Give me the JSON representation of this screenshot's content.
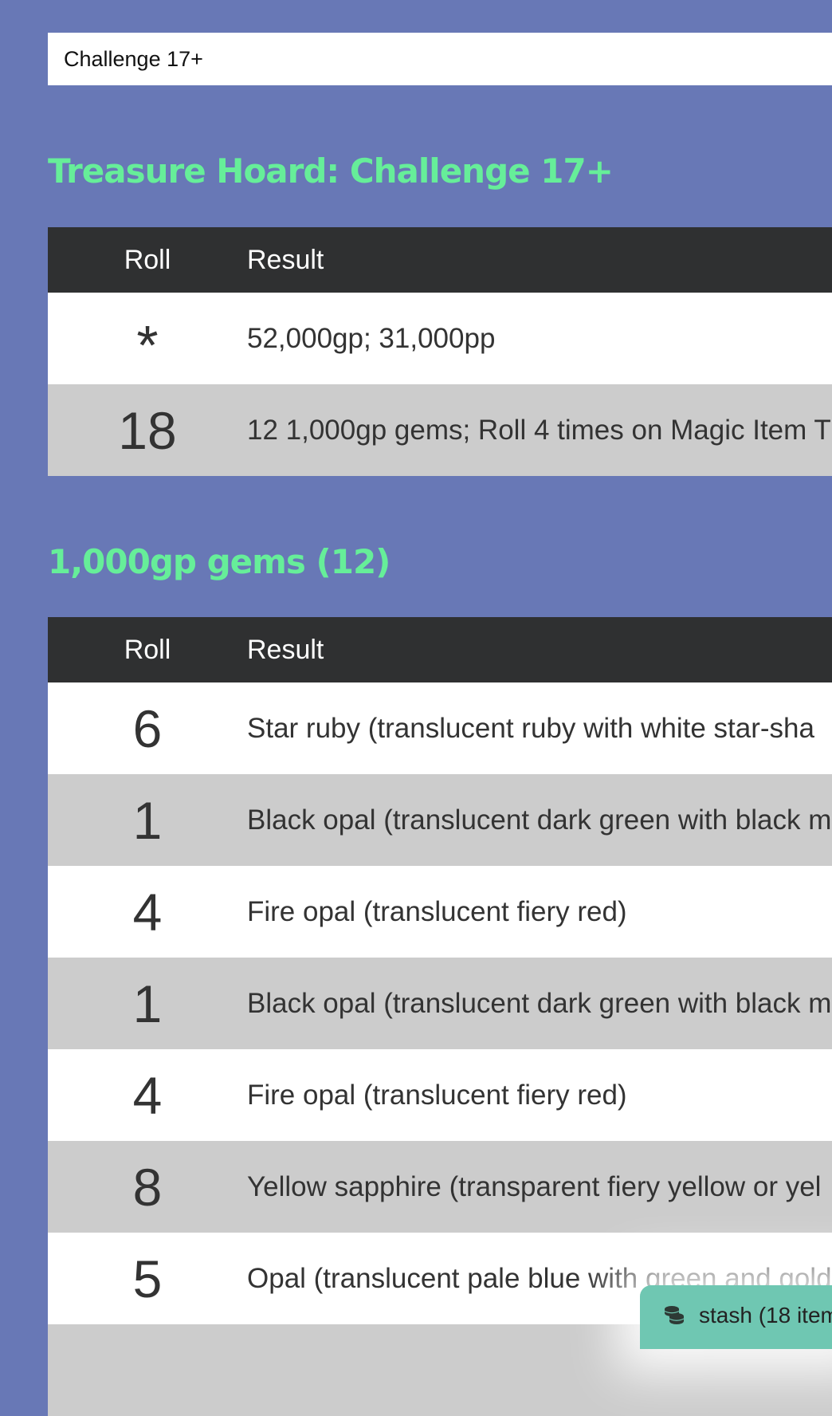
{
  "select": {
    "value": "Challenge 17+"
  },
  "hoard": {
    "title": "Treasure Hoard: Challenge 17+",
    "headers": {
      "roll": "Roll",
      "result": "Result"
    },
    "rows": [
      {
        "roll": "*",
        "result": "52,000gp; 31,000pp"
      },
      {
        "roll": "18",
        "result": "12 1,000gp gems; Roll 4 times on Magic Item T"
      }
    ]
  },
  "gems": {
    "title": "1,000gp gems (12)",
    "headers": {
      "roll": "Roll",
      "result": "Result"
    },
    "rows": [
      {
        "roll": "6",
        "result": "Star ruby (translucent ruby with white star-sha"
      },
      {
        "roll": "1",
        "result": "Black opal (translucent dark green with black m"
      },
      {
        "roll": "4",
        "result": "Fire opal (translucent fiery red)"
      },
      {
        "roll": "1",
        "result": "Black opal (translucent dark green with black m"
      },
      {
        "roll": "4",
        "result": "Fire opal (translucent fiery red)"
      },
      {
        "roll": "8",
        "result": "Yellow sapphire (transparent fiery yellow or yel"
      },
      {
        "roll": "5",
        "result": "Opal (translucent pale blue with green and gold"
      }
    ]
  },
  "stash": {
    "label": "stash (18 item",
    "icon": "coins-icon"
  }
}
